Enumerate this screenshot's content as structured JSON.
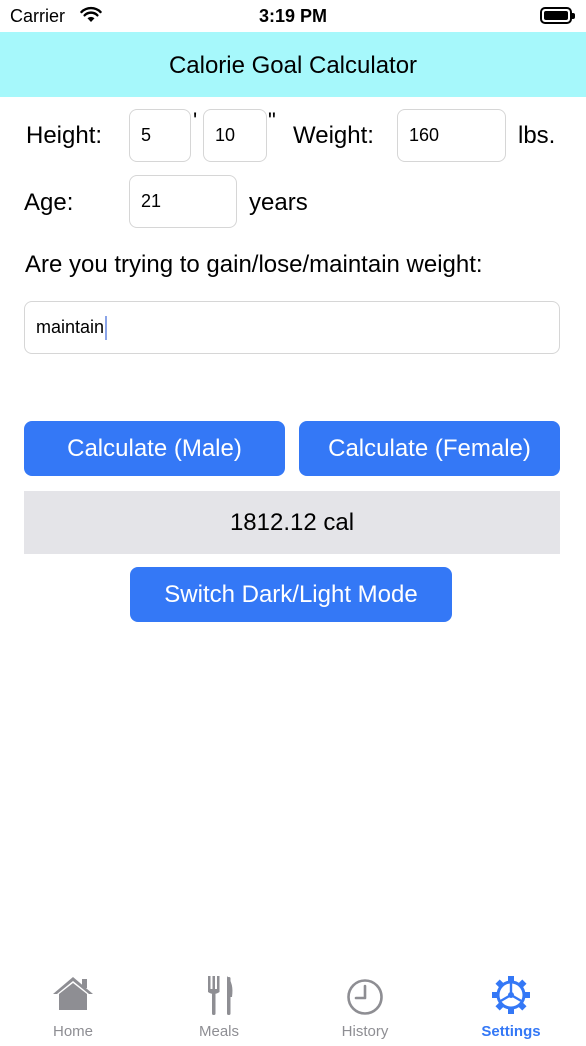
{
  "status_bar": {
    "carrier": "Carrier",
    "time": "3:19 PM"
  },
  "header": {
    "title": "Calorie Goal Calculator",
    "background": "#a6f8fb"
  },
  "form": {
    "height_label": "Height:",
    "height_feet": "5",
    "feet_mark": "'",
    "height_inches": "10",
    "inches_mark": "\"",
    "weight_label": "Weight:",
    "weight_value": "160",
    "weight_unit": "lbs.",
    "age_label": "Age:",
    "age_value": "21",
    "age_unit": "years",
    "goal_question": "Are you trying to gain/lose/maintain weight:",
    "goal_value": "maintain"
  },
  "buttons": {
    "calc_male": "Calculate (Male)",
    "calc_female": "Calculate (Female)",
    "toggle_mode": "Switch Dark/Light Mode",
    "color": "#3478f6"
  },
  "result": {
    "text": "1812.12 cal"
  },
  "tab_bar": {
    "active_color": "#3478f6",
    "inactive_color": "#8e8e93",
    "tabs": [
      {
        "label": "Home",
        "icon": "house-icon"
      },
      {
        "label": "Meals",
        "icon": "fork-knife-icon"
      },
      {
        "label": "History",
        "icon": "clock-icon"
      },
      {
        "label": "Settings",
        "icon": "gear-icon",
        "active": true
      }
    ]
  }
}
